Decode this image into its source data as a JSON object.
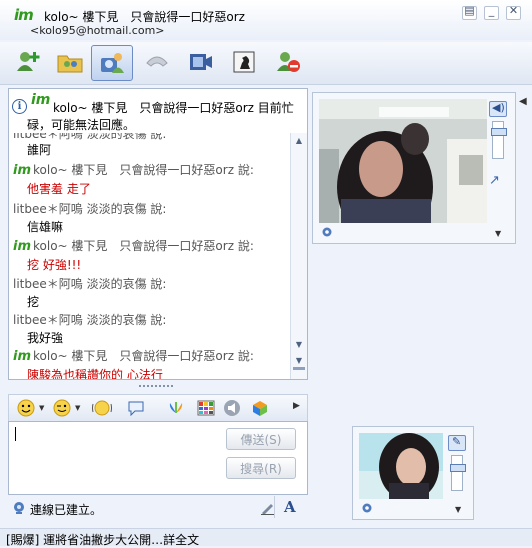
{
  "title": {
    "logo": "im",
    "contact_name": "kolo~ 樓下見　只會說得一口好惡orz",
    "contact_email": "<kolo95@hotmail.com>"
  },
  "toolbar": {
    "buttons": [
      "add-contact",
      "share-folders",
      "webcam",
      "voice-call",
      "video-clip",
      "games",
      "block"
    ]
  },
  "status_banner": {
    "logo": "im",
    "line1": "kolo~ 樓下見　只會說得一口好惡orz 目前忙",
    "line2": "碌，可能無法回應。"
  },
  "messages": [
    {
      "type": "text",
      "text": "litbee＊阿嗚 淡淡的哀傷 說:",
      "color": "#555555"
    },
    {
      "type": "text",
      "text": "誰阿",
      "color": "#000000"
    },
    {
      "type": "sender",
      "logo": "im",
      "text": "kolo~ 樓下見　只會說得一口好惡orz 說:"
    },
    {
      "type": "text",
      "text": "他害羞 走了",
      "color": "#cc0000"
    },
    {
      "type": "sender",
      "logo": "",
      "text": "litbee＊阿嗚 淡淡的哀傷 說:"
    },
    {
      "type": "text",
      "text": "信雄嘛",
      "color": "#000000"
    },
    {
      "type": "sender",
      "logo": "im",
      "text": "kolo~ 樓下見　只會說得一口好惡orz 說:"
    },
    {
      "type": "text",
      "text": "挖 好強!!!",
      "color": "#cc0000"
    },
    {
      "type": "sender",
      "logo": "",
      "text": "litbee＊阿嗚 淡淡的哀傷 說:"
    },
    {
      "type": "text",
      "text": "挖",
      "color": "#000000"
    },
    {
      "type": "sender",
      "logo": "",
      "text": "litbee＊阿嗚 淡淡的哀傷 說:"
    },
    {
      "type": "text",
      "text": "我好強",
      "color": "#000000"
    },
    {
      "type": "sender",
      "logo": "im",
      "text": "kolo~ 樓下見　只會說得一口好惡orz 說:"
    },
    {
      "type": "text",
      "text": "陳駿為也稱讚你的 心法行",
      "color": "#cc0000"
    }
  ],
  "input": {
    "value": "",
    "send_label": "傳送(S)",
    "search_label": "搜尋(R)"
  },
  "status": {
    "connection": "連線已建立。",
    "ticker": "[賜爆] 運將省油撇步大公開…詳全文"
  },
  "colors": {
    "accent_green": "#2f9a1c",
    "message_red": "#cc0000",
    "frame_blue": "#a9b8cf"
  }
}
